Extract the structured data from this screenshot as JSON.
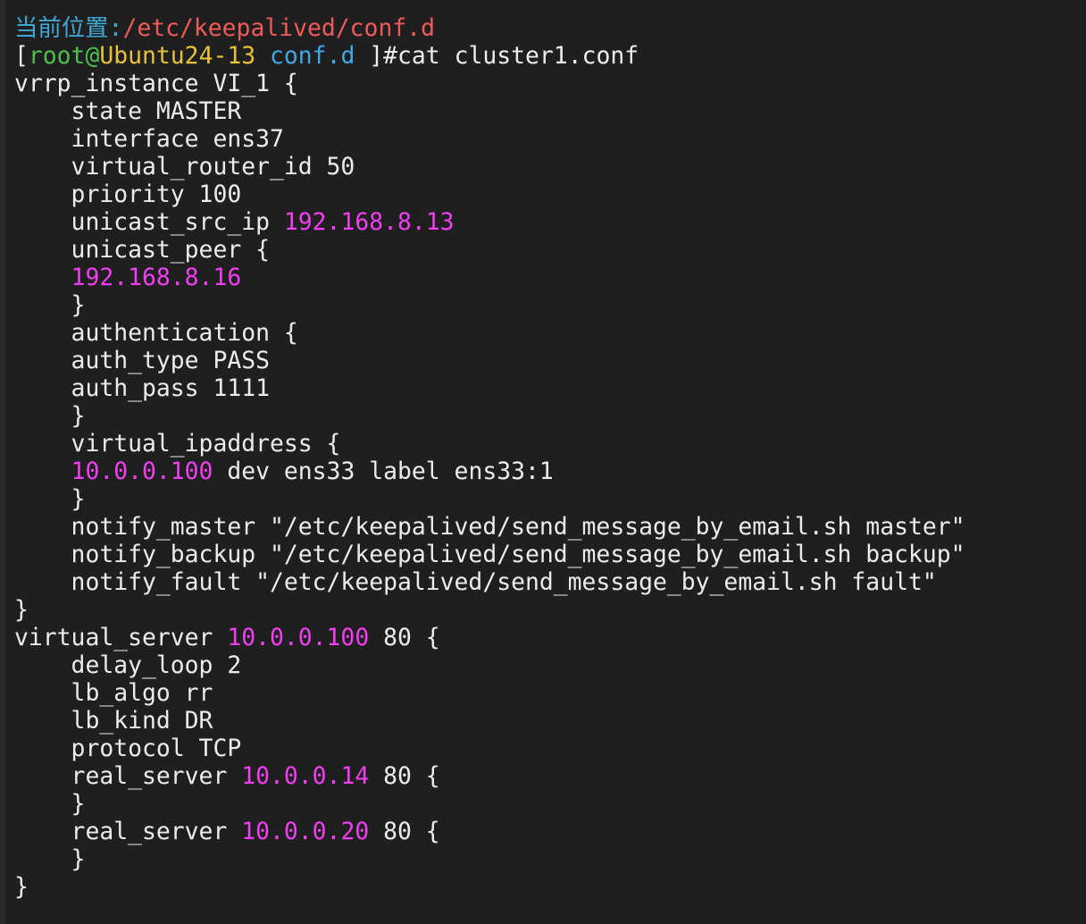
{
  "window": {
    "colors": {
      "background": "#1f1f1f",
      "foreground": "#ececec",
      "location_label": "#3fa8d2",
      "location_path": "#ef5a5a",
      "user": "#4cc04c",
      "host": "#e8c23b",
      "cwd": "#41a7e8",
      "ip": "#f23ef2"
    }
  },
  "terminal": {
    "location_label": "当前位置:",
    "location_path": "/etc/keepalived/conf.d",
    "prompt": {
      "open_bracket": "[",
      "user": "root",
      "at": "@",
      "host": "Ubuntu24-13",
      "cwd": "conf.d",
      "close_and_hash": " ]#",
      "command": "cat cluster1.conf"
    },
    "lines": [
      [
        "vrrp_instance VI_1 {"
      ],
      [
        "    state MASTER"
      ],
      [
        "    interface ens37"
      ],
      [
        "    virtual_router_id 50"
      ],
      [
        "    priority 100"
      ],
      [
        "    unicast_src_ip ",
        "192.168.8.13"
      ],
      [
        "    unicast_peer {"
      ],
      [
        "    ",
        "192.168.8.16"
      ],
      [
        "    }"
      ],
      [
        "    authentication {"
      ],
      [
        "    auth_type PASS"
      ],
      [
        "    auth_pass 1111"
      ],
      [
        "    }"
      ],
      [
        "    virtual_ipaddress {"
      ],
      [
        "    ",
        "10.0.0.100",
        " dev ens33 label ens33:1"
      ],
      [
        "    }"
      ],
      [
        "    notify_master \"/etc/keepalived/send_message_by_email.sh master\""
      ],
      [
        "    notify_backup \"/etc/keepalived/send_message_by_email.sh backup\""
      ],
      [
        "    notify_fault \"/etc/keepalived/send_message_by_email.sh fault\""
      ],
      [
        "}"
      ],
      [
        "virtual_server ",
        "10.0.0.100",
        " 80 {"
      ],
      [
        "    delay_loop 2"
      ],
      [
        "    lb_algo rr"
      ],
      [
        "    lb_kind DR"
      ],
      [
        "    protocol TCP"
      ],
      [
        "    real_server ",
        "10.0.0.14",
        " 80 {"
      ],
      [
        "    }"
      ],
      [
        "    real_server ",
        "10.0.0.20",
        " 80 {"
      ],
      [
        "    }"
      ],
      [
        "}"
      ]
    ]
  }
}
